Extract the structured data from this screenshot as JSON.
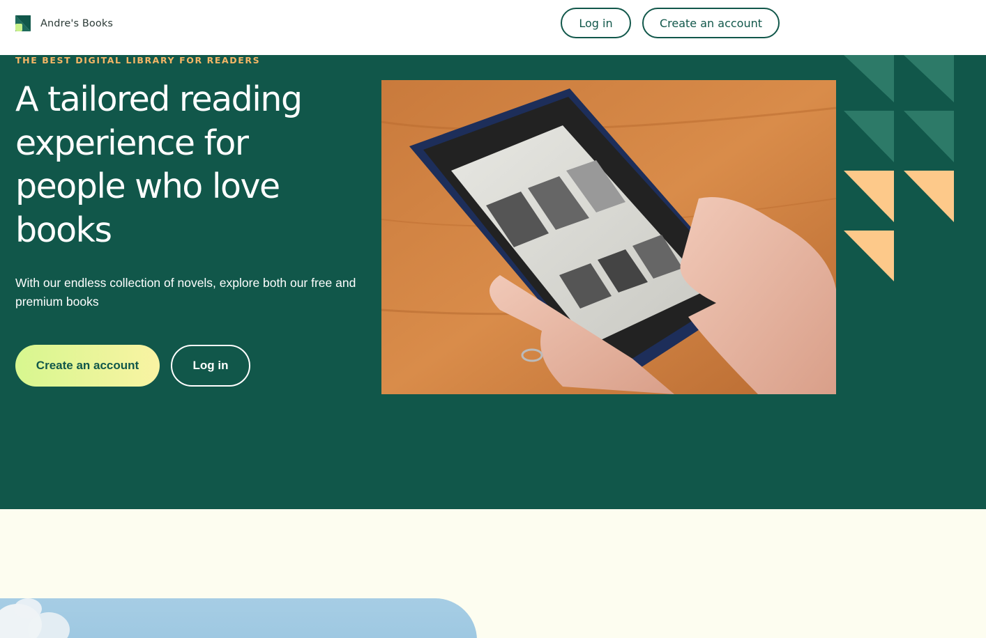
{
  "nav": {
    "brand_name": "Andre's Books",
    "login_label": "Log in",
    "create_label": "Create an account"
  },
  "hero": {
    "eyebrow": "THE BEST DIGITAL LIBRARY FOR READERS",
    "headline": "A tailored reading experience for people who love books",
    "subtext": "With our endless collection of novels, explore both our free and premium books",
    "create_label": "Create an account",
    "login_label": "Log in",
    "image_alt": "Hands holding a Kindle e-reader"
  },
  "colors": {
    "brand_green": "#11574a",
    "accent_orange": "#f5b666",
    "peach": "#fdc98a",
    "button_gradient_start": "#d7f78f",
    "button_gradient_end": "#f9f3a3",
    "cream": "#fdfdf0"
  },
  "icons": {
    "logo": "triangle-logo-icon"
  }
}
